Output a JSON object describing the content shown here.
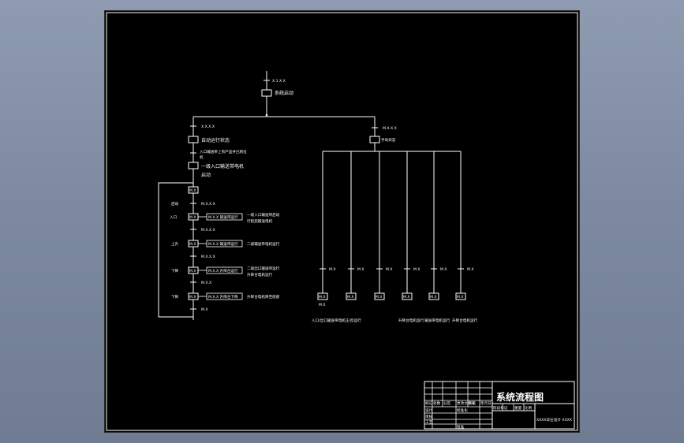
{
  "drawing": {
    "start": {
      "label": "系统启动",
      "transition": "X.1.X.X"
    },
    "auto": {
      "transition": "X.X.X.X",
      "label": "自动运行状态",
      "note": "入口输送带上有产品并已到位",
      "note2": "机",
      "step2_label": "一级入口输送带电机",
      "step2_sub": "启动",
      "sequence_block": "M.X",
      "steps": [
        {
          "side_label": "启动",
          "transition": "M.X.X.X",
          "box": "M.X",
          "action": "M.X.X 输送带运行",
          "desc": "一级入口输送带启动",
          "desc2": "行程后输送电机",
          "after": "M.X.X.X"
        },
        {
          "side_label": "入口",
          "transition": "",
          "box": "M.X",
          "action": "M.X.X 输送带运行",
          "desc": "二级输送带电机运行",
          "desc2": "",
          "after": "M.X.X.X"
        },
        {
          "side_label": "上升",
          "transition": "",
          "box": "M.X",
          "action": "M.X.X 升降台运行",
          "desc": "二级出口输送带运行",
          "desc2": "升降台电机运行",
          "after": "M.X.X"
        },
        {
          "side_label": "下降",
          "transition": "",
          "box": "M.X",
          "action": "M.X.X 升降台下降",
          "desc": "升降台电机降至底部",
          "desc2": "",
          "after": "M.X"
        }
      ]
    },
    "manual": {
      "transition": "M.X.X.X",
      "label": "手动状态",
      "branches": [
        {
          "transition": "M.X",
          "box": "M.X",
          "sub": "M.X"
        },
        {
          "transition": "M.X",
          "box": "M.X",
          "sub": ""
        },
        {
          "transition": "M.X",
          "box": "M.X",
          "sub": ""
        },
        {
          "transition": "M.X",
          "box": "M.X",
          "sub": ""
        },
        {
          "transition": "M.X",
          "box": "M.X",
          "sub": ""
        },
        {
          "transition": "M.X",
          "box": "M.X",
          "sub": ""
        }
      ],
      "bottom_labels": [
        "入口/出口输送带电机正/反运行",
        "升降台电机运行",
        "输送带电机运行",
        "升降台电机运行"
      ]
    }
  },
  "title_block": {
    "title": "系统流程图",
    "bottom_text": "XXXX毕业设计 XXXX",
    "cells": [
      "标记",
      "处数",
      "分区",
      "更改文件号",
      "签名",
      "年月日",
      "设计",
      "标准化",
      "审核",
      "工艺",
      "批准",
      "阶段标记",
      "重量",
      "比例"
    ]
  }
}
